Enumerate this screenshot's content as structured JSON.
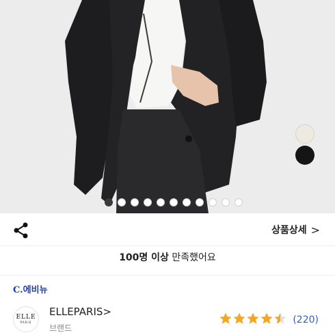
{
  "product": {
    "image_alt": "black jacket worn over white top",
    "swatches": [
      "ivory",
      "black"
    ],
    "carousel": {
      "total": 11,
      "active_index": 0
    }
  },
  "action_bar": {
    "share_icon": "share-icon",
    "detail_label": "상품상세",
    "detail_chevron": ">"
  },
  "satisfaction": {
    "highlight": "100명 이상",
    "rest": " 만족했어요"
  },
  "shop": {
    "name": "C.에비뉴"
  },
  "brand": {
    "logo_top": "ELLE",
    "logo_bottom": "PARIS",
    "name": "ELLEPARIS",
    "chevron": ">",
    "type": "브랜드"
  },
  "rating": {
    "stars": 4.5,
    "review_count": "(220)",
    "star_color": "#f5a623",
    "star_empty_color": "#e0e0e0"
  },
  "colors": {
    "shop_name": "#1a3fb0",
    "review_link": "#2e5fc8"
  }
}
